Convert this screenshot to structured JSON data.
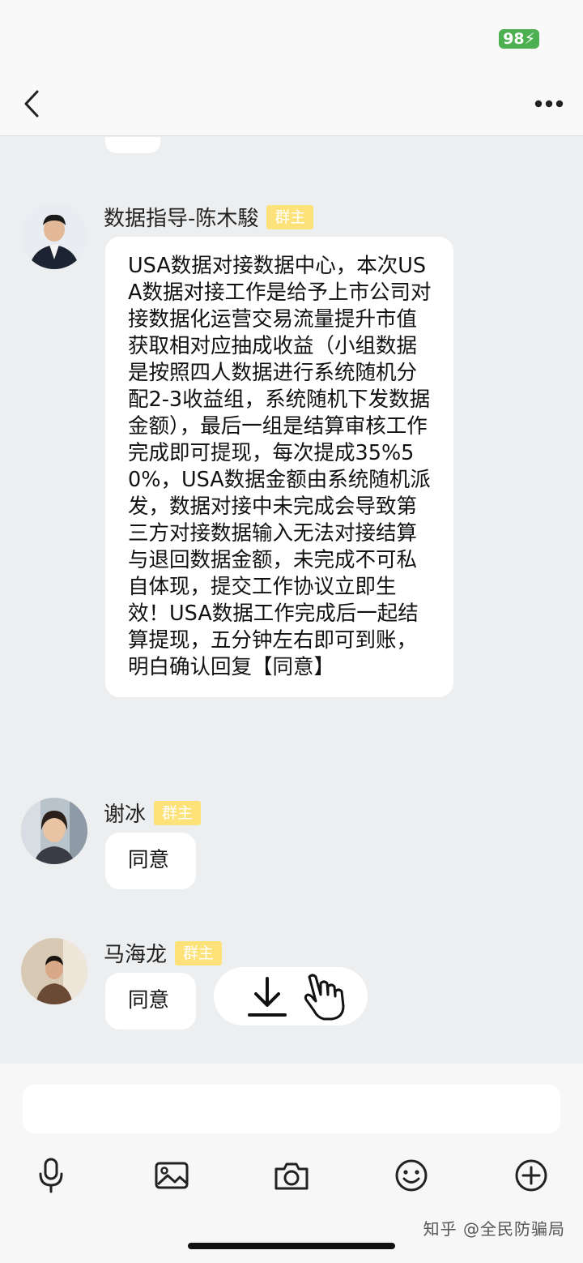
{
  "status_bar": {
    "battery": "98"
  },
  "nav": {
    "back_icon": "chevron-left-icon",
    "more_icon": "more-horizontal-icon"
  },
  "messages": [
    {
      "sender": "数据指导-陈木駿",
      "badge": "群主",
      "text": "USA数据对接数据中心，本次USA数据对接工作是给予上市公司对接数据化运营交易流量提升市值获取相对应抽成收益（小组数据是按照四人数据进行系统随机分配2-3收益组，系统随机下发数据金额），最后一组是结算审核工作完成即可提现，每次提成35%50%，USA数据金额由系统随机派发，数据对接中未完成会导致第三方对接数据输入无法对接结算与退回数据金额，未完成不可私自体现，提交工作协议立即生效！USA数据工作完成后一起结算提现，五分钟左右即可到账，\n明白确认回复【同意】"
    },
    {
      "sender": "谢冰",
      "badge": "群主",
      "text": "同意"
    },
    {
      "sender": "马海龙",
      "badge": "群主",
      "text": "同意"
    }
  ],
  "floating_actions": {
    "download_icon": "download-icon",
    "hand_icon": "pointing-hand-icon"
  },
  "input": {
    "placeholder": ""
  },
  "toolbar": [
    "microphone-icon",
    "image-icon",
    "camera-icon",
    "emoji-icon",
    "plus-icon"
  ],
  "watermark": "知乎 @全民防骗局"
}
